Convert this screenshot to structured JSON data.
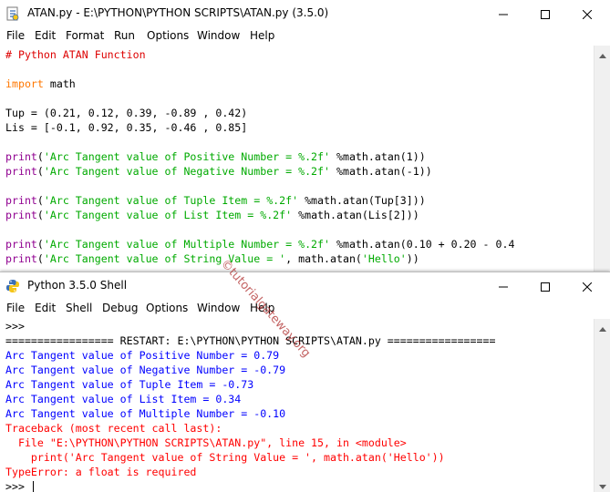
{
  "editor": {
    "title": "ATAN.py - E:\\PYTHON\\PYTHON SCRIPTS\\ATAN.py (3.5.0)",
    "menu": [
      "File",
      "Edit",
      "Format",
      "Run",
      "Options",
      "Window",
      "Help"
    ],
    "lines": [
      [
        {
          "t": "# Python ATAN Function",
          "c": "comment"
        }
      ],
      [],
      [
        {
          "t": "import",
          "c": "keyword"
        },
        {
          "t": " math",
          "c": "plain"
        }
      ],
      [],
      [
        {
          "t": "Tup = (0.21, 0.12, 0.39, -0.89 , 0.42)",
          "c": "plain"
        }
      ],
      [
        {
          "t": "Lis = [-0.1, 0.92, 0.35, -0.46 , 0.85]",
          "c": "plain"
        }
      ],
      [],
      [
        {
          "t": "print",
          "c": "builtin"
        },
        {
          "t": "(",
          "c": "plain"
        },
        {
          "t": "'Arc Tangent value of Positive Number = %.2f'",
          "c": "string"
        },
        {
          "t": " %math.atan(1))",
          "c": "plain"
        }
      ],
      [
        {
          "t": "print",
          "c": "builtin"
        },
        {
          "t": "(",
          "c": "plain"
        },
        {
          "t": "'Arc Tangent value of Negative Number = %.2f'",
          "c": "string"
        },
        {
          "t": " %math.atan(-1))",
          "c": "plain"
        }
      ],
      [],
      [
        {
          "t": "print",
          "c": "builtin"
        },
        {
          "t": "(",
          "c": "plain"
        },
        {
          "t": "'Arc Tangent value of Tuple Item = %.2f'",
          "c": "string"
        },
        {
          "t": " %math.atan(Tup[3]))",
          "c": "plain"
        }
      ],
      [
        {
          "t": "print",
          "c": "builtin"
        },
        {
          "t": "(",
          "c": "plain"
        },
        {
          "t": "'Arc Tangent value of List Item = %.2f'",
          "c": "string"
        },
        {
          "t": " %math.atan(Lis[2]))",
          "c": "plain"
        }
      ],
      [],
      [
        {
          "t": "print",
          "c": "builtin"
        },
        {
          "t": "(",
          "c": "plain"
        },
        {
          "t": "'Arc Tangent value of Multiple Number = %.2f'",
          "c": "string"
        },
        {
          "t": " %math.atan(0.10 + 0.20 - 0.4",
          "c": "plain"
        }
      ],
      [
        {
          "t": "print",
          "c": "builtin"
        },
        {
          "t": "(",
          "c": "plain"
        },
        {
          "t": "'Arc Tangent value of String Value = '",
          "c": "string"
        },
        {
          "t": ", math.atan(",
          "c": "plain"
        },
        {
          "t": "'Hello'",
          "c": "string"
        },
        {
          "t": "))",
          "c": "plain"
        }
      ]
    ]
  },
  "shell": {
    "title": "Python 3.5.0 Shell",
    "menu": [
      "File",
      "Edit",
      "Shell",
      "Debug",
      "Options",
      "Window",
      "Help"
    ],
    "lines": [
      [
        {
          "t": ">>> ",
          "c": "plain"
        }
      ],
      [
        {
          "t": "================= RESTART: E:\\PYTHON\\PYTHON SCRIPTS\\ATAN.py =================",
          "c": "plain"
        }
      ],
      [
        {
          "t": "Arc Tangent value of Positive Number = 0.79",
          "c": "output"
        }
      ],
      [
        {
          "t": "Arc Tangent value of Negative Number = -0.79",
          "c": "output"
        }
      ],
      [
        {
          "t": "Arc Tangent value of Tuple Item = -0.73",
          "c": "output"
        }
      ],
      [
        {
          "t": "Arc Tangent value of List Item = 0.34",
          "c": "output"
        }
      ],
      [
        {
          "t": "Arc Tangent value of Multiple Number = -0.10",
          "c": "output"
        }
      ],
      [
        {
          "t": "Traceback (most recent call last):",
          "c": "error"
        }
      ],
      [
        {
          "t": "  File \"E:\\PYTHON\\PYTHON SCRIPTS\\ATAN.py\", line 15, in <module>",
          "c": "error"
        }
      ],
      [
        {
          "t": "    print('Arc Tangent value of String Value = ', math.atan('Hello'))",
          "c": "error"
        }
      ],
      [
        {
          "t": "TypeError: a float is required",
          "c": "error"
        }
      ],
      [
        {
          "t": ">>> ",
          "c": "plain"
        }
      ]
    ]
  },
  "watermark": "©tutorialgateway.org",
  "colors": {
    "comment": "#dd0000",
    "keyword": "#ff7700",
    "builtin": "#900090",
    "string": "#00aa00",
    "output": "#0000ff",
    "error": "#ff0000"
  }
}
